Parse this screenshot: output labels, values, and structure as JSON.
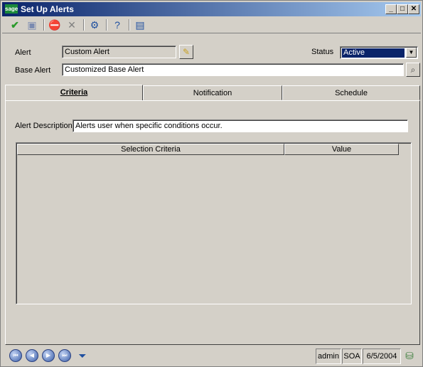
{
  "window": {
    "title": "Set Up Alerts",
    "logo": "sage"
  },
  "titlebar_buttons": {
    "minimize": "_",
    "maximize": "□",
    "close": "✕"
  },
  "toolbar": {
    "accept_icon": "checkmark-icon",
    "save_icon": "floppy-icon",
    "delete_icon": "stop-icon",
    "cancel_icon": "x-icon",
    "customize_icon": "customize-icon",
    "help_icon": "help-icon",
    "info_icon": "info-icon"
  },
  "form": {
    "alert_label": "Alert",
    "alert_value": "Custom Alert",
    "base_alert_label": "Base Alert",
    "base_alert_value": "Customized Base Alert",
    "status_label": "Status",
    "status_value": "Active"
  },
  "tabs": [
    {
      "label": "Criteria",
      "active": true
    },
    {
      "label": "Notification",
      "active": false
    },
    {
      "label": "Schedule",
      "active": false
    }
  ],
  "criteria": {
    "description_label": "Alert Description",
    "description_value": "Alerts user when specific conditions occur.",
    "columns": [
      "Selection Criteria",
      "Value"
    ]
  },
  "status": {
    "user": "admin",
    "company": "SOA",
    "date": "6/5/2004"
  }
}
